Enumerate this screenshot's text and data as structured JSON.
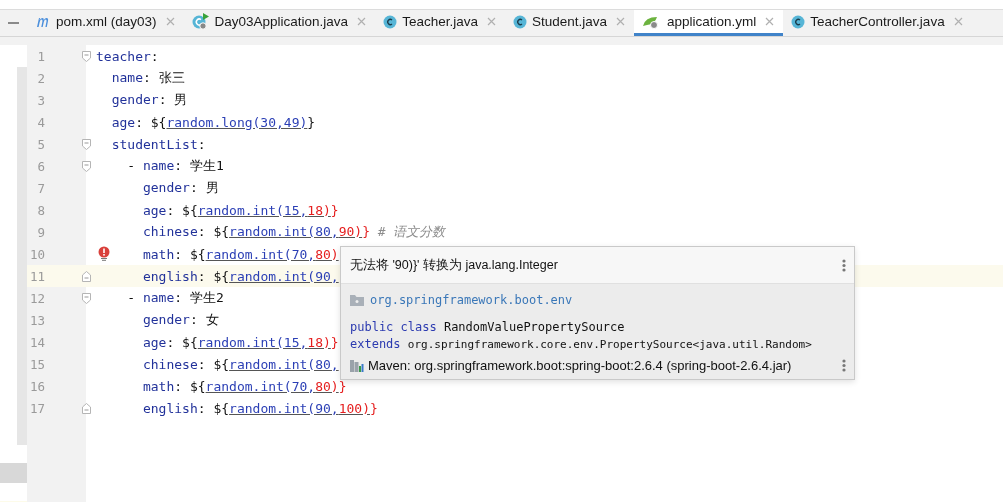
{
  "tabs": [
    {
      "label": "pom.xml (day03)",
      "kind": "maven",
      "selected": false
    },
    {
      "label": "Day03Application.java",
      "kind": "application",
      "selected": false
    },
    {
      "label": "Teacher.java",
      "kind": "class",
      "selected": false
    },
    {
      "label": "Student.java",
      "kind": "class",
      "selected": false
    },
    {
      "label": "application.yml",
      "kind": "yaml",
      "selected": true
    },
    {
      "label": "TeacherController.java",
      "kind": "class",
      "selected": false
    }
  ],
  "editor": {
    "lines": [
      {
        "number": "1",
        "fold_open": true,
        "fold_close": false,
        "error": false,
        "current": false,
        "tokens": [
          {
            "kind": "key",
            "text": "teacher"
          },
          {
            "kind": "punct",
            "text": ":"
          }
        ]
      },
      {
        "number": "2",
        "fold_open": false,
        "fold_close": false,
        "error": false,
        "current": false,
        "tokens": [
          {
            "kind": "key",
            "text": "  name"
          },
          {
            "kind": "punct",
            "text": ": "
          },
          {
            "kind": "value",
            "text": "张三"
          }
        ]
      },
      {
        "number": "3",
        "fold_open": false,
        "fold_close": false,
        "error": false,
        "current": false,
        "tokens": [
          {
            "kind": "key",
            "text": "  gender"
          },
          {
            "kind": "punct",
            "text": ": "
          },
          {
            "kind": "value",
            "text": "男"
          }
        ]
      },
      {
        "number": "4",
        "fold_open": false,
        "fold_close": false,
        "error": false,
        "current": false,
        "tokens": [
          {
            "kind": "key",
            "text": "  age"
          },
          {
            "kind": "punct",
            "text": ": ${"
          },
          {
            "kind": "ref",
            "text": "random.long(30,49)"
          },
          {
            "kind": "punct",
            "text": "}"
          }
        ]
      },
      {
        "number": "5",
        "fold_open": true,
        "fold_close": false,
        "error": false,
        "current": false,
        "tokens": [
          {
            "kind": "key",
            "text": "  studentList"
          },
          {
            "kind": "punct",
            "text": ":"
          }
        ]
      },
      {
        "number": "6",
        "fold_open": true,
        "fold_close": false,
        "error": false,
        "current": false,
        "tokens": [
          {
            "kind": "punct",
            "text": "    - "
          },
          {
            "kind": "key",
            "text": "name"
          },
          {
            "kind": "punct",
            "text": ": "
          },
          {
            "kind": "value",
            "text": "学生1"
          }
        ]
      },
      {
        "number": "7",
        "fold_open": false,
        "fold_close": false,
        "error": false,
        "current": false,
        "tokens": [
          {
            "kind": "key",
            "text": "      gender"
          },
          {
            "kind": "punct",
            "text": ": "
          },
          {
            "kind": "value",
            "text": "男"
          }
        ]
      },
      {
        "number": "8",
        "fold_open": false,
        "fold_close": false,
        "error": false,
        "current": false,
        "tokens": [
          {
            "kind": "key",
            "text": "      age"
          },
          {
            "kind": "punct",
            "text": ": ${"
          },
          {
            "kind": "ref",
            "text": "random.int(15,"
          },
          {
            "kind": "ref-error",
            "text": "18)"
          },
          {
            "kind": "error",
            "text": "}"
          }
        ]
      },
      {
        "number": "9",
        "fold_open": false,
        "fold_close": false,
        "error": false,
        "current": false,
        "tokens": [
          {
            "kind": "key",
            "text": "      chinese"
          },
          {
            "kind": "punct",
            "text": ": ${"
          },
          {
            "kind": "ref",
            "text": "random.int(80,"
          },
          {
            "kind": "ref-error",
            "text": "90)"
          },
          {
            "kind": "error",
            "text": "}"
          },
          {
            "kind": "comment",
            "text": " # 语文分数"
          }
        ]
      },
      {
        "number": "10",
        "fold_open": false,
        "fold_close": false,
        "error": true,
        "current": false,
        "tokens": [
          {
            "kind": "key",
            "text": "      math"
          },
          {
            "kind": "punct",
            "text": ": ${"
          },
          {
            "kind": "ref",
            "text": "random.int(70,"
          },
          {
            "kind": "ref-error",
            "text": "80)"
          }
        ]
      },
      {
        "number": "11",
        "fold_open": false,
        "fold_close": true,
        "error": false,
        "current": true,
        "tokens": [
          {
            "kind": "key",
            "text": "      english"
          },
          {
            "kind": "punct",
            "text": ": ${"
          },
          {
            "kind": "ref",
            "text": "random.int(90,"
          }
        ]
      },
      {
        "number": "12",
        "fold_open": true,
        "fold_close": false,
        "error": false,
        "current": false,
        "tokens": [
          {
            "kind": "punct",
            "text": "    - "
          },
          {
            "kind": "key",
            "text": "name"
          },
          {
            "kind": "punct",
            "text": ": "
          },
          {
            "kind": "value",
            "text": "学生2"
          }
        ]
      },
      {
        "number": "13",
        "fold_open": false,
        "fold_close": false,
        "error": false,
        "current": false,
        "tokens": [
          {
            "kind": "key",
            "text": "      gender"
          },
          {
            "kind": "punct",
            "text": ": "
          },
          {
            "kind": "value",
            "text": "女"
          }
        ]
      },
      {
        "number": "14",
        "fold_open": false,
        "fold_close": false,
        "error": false,
        "current": false,
        "tokens": [
          {
            "kind": "key",
            "text": "      age"
          },
          {
            "kind": "punct",
            "text": ": ${"
          },
          {
            "kind": "ref",
            "text": "random.int(15,"
          },
          {
            "kind": "ref-error",
            "text": "18)"
          },
          {
            "kind": "error",
            "text": "}"
          }
        ]
      },
      {
        "number": "15",
        "fold_open": false,
        "fold_close": false,
        "error": false,
        "current": false,
        "tokens": [
          {
            "kind": "key",
            "text": "      chinese"
          },
          {
            "kind": "punct",
            "text": ": ${"
          },
          {
            "kind": "ref",
            "text": "random.int(80,"
          }
        ]
      },
      {
        "number": "16",
        "fold_open": false,
        "fold_close": false,
        "error": false,
        "current": false,
        "tokens": [
          {
            "kind": "key",
            "text": "      math"
          },
          {
            "kind": "punct",
            "text": ": ${"
          },
          {
            "kind": "ref",
            "text": "random.int(70,"
          },
          {
            "kind": "ref-error",
            "text": "80)"
          },
          {
            "kind": "error",
            "text": "}"
          }
        ]
      },
      {
        "number": "17",
        "fold_open": false,
        "fold_close": true,
        "error": false,
        "current": false,
        "tokens": [
          {
            "kind": "key",
            "text": "      english"
          },
          {
            "kind": "punct",
            "text": ": ${"
          },
          {
            "kind": "ref",
            "text": "random.int(90,"
          },
          {
            "kind": "ref-error",
            "text": "100)"
          },
          {
            "kind": "error",
            "text": "}"
          }
        ]
      }
    ]
  },
  "popup": {
    "message": "无法将 '90)}' 转换为 java.lang.Integer",
    "package": "org.springframework.boot.env",
    "declaration": [
      {
        "kind": "keyword",
        "text": "public class "
      },
      {
        "kind": "name",
        "text": "RandomValuePropertySource"
      }
    ],
    "extends": [
      {
        "kind": "keyword",
        "text": "extends "
      },
      {
        "kind": "type",
        "text": "org.springframework.core.env.PropertySource<java.util.Random>"
      }
    ],
    "library": "Maven: org.springframework.boot:spring-boot:2.6.4 (spring-boot-2.6.4.jar)"
  }
}
